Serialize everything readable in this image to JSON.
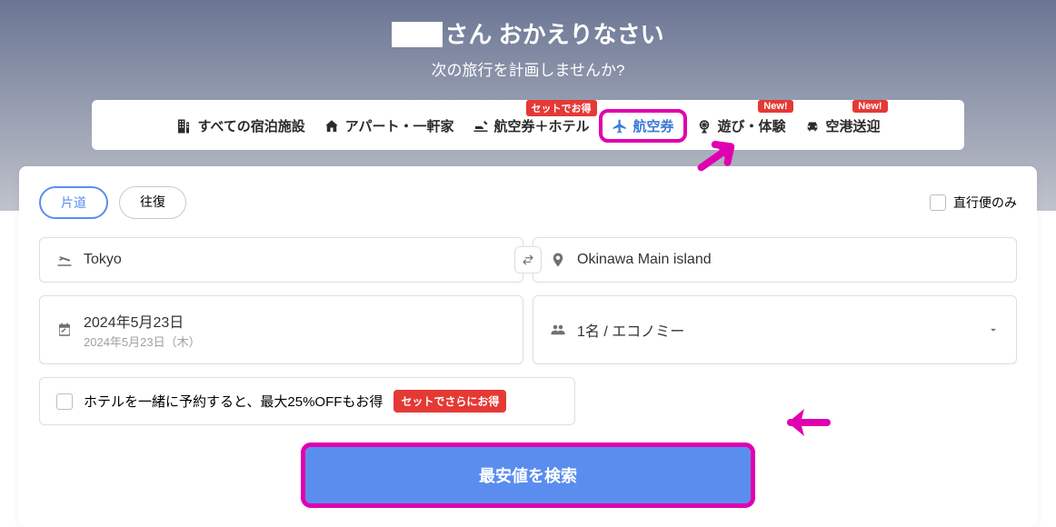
{
  "hero": {
    "greeting_suffix": "さん おかえりなさい",
    "subtitle": "次の旅行を計画しませんか?"
  },
  "tabs": {
    "accommodations": "すべての宿泊施設",
    "homes": "アパート・一軒家",
    "flight_hotel": "航空券＋ホテル",
    "flight_hotel_badge": "セットでお得",
    "flights": "航空券",
    "activities": "遊び・体験",
    "activities_badge": "New!",
    "transfer": "空港送迎",
    "transfer_badge": "New!"
  },
  "form": {
    "oneway": "片道",
    "roundtrip": "往復",
    "direct_only": "直行便のみ",
    "origin": "Tokyo",
    "destination": "Okinawa Main island",
    "date_main": "2024年5月23日",
    "date_sub": "2024年5月23日（木）",
    "pax": "1名 / エコノミー",
    "hotel_bundle": "ホテルを一緒に予約すると、最大25%OFFもお得",
    "hotel_bundle_badge": "セットでさらにお得",
    "search_button": "最安値を検索"
  }
}
